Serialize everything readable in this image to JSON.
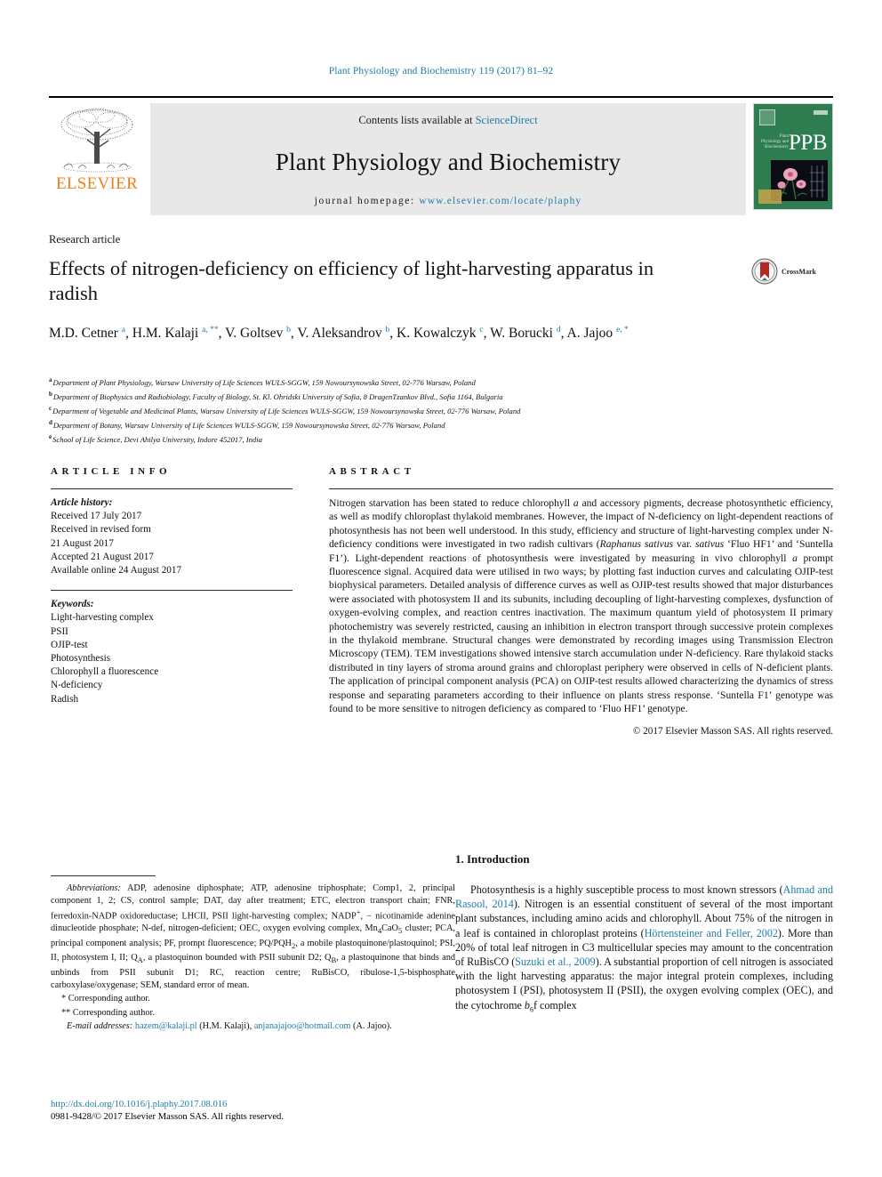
{
  "running_head": "Plant Physiology and Biochemistry 119 (2017) 81–92",
  "masthead": {
    "publisher": "ELSEVIER",
    "contents_prefix": "Contents lists available at",
    "contents_link": "ScienceDirect",
    "journal_title": "Plant Physiology and Biochemistry",
    "homepage_prefix": "journal homepage:",
    "homepage_url": "www.elsevier.com/locate/plaphy",
    "cover_badge": "PPB",
    "cover_caption": "Plant Physiology and Biochemistry"
  },
  "article": {
    "type": "Research article",
    "title": "Effects of nitrogen-deficiency on efficiency of light-harvesting apparatus in radish",
    "crossmark_label": "CrossMark",
    "authors_html": "M.D. Cetner <sup>a</sup>, H.M. Kalaji <sup>a, **</sup>, V. Goltsev <sup>b</sup>, V. Aleksandrov <sup>b</sup>, K. Kowalczyk <sup>c</sup>, W. Borucki <sup>d</sup>, A. Jajoo <sup>e, *</sup>",
    "affiliations": [
      {
        "mark": "a",
        "text": "Department of Plant Physiology, Warsaw University of Life Sciences WULS-SGGW, 159 Nowoursynowska Street, 02-776 Warsaw, Poland"
      },
      {
        "mark": "b",
        "text": "Department of Biophysics and Radiobiology, Faculty of Biology, St. Kl. Ohridski University of Sofia, 8 DragenTzankov Blvd., Sofia 1164, Bulgaria"
      },
      {
        "mark": "c",
        "text": "Department of Vegetable and Medicinal Plants, Warsaw University of Life Sciences WULS-SGGW, 159 Nowoursynowska Street, 02-776 Warsaw, Poland"
      },
      {
        "mark": "d",
        "text": "Department of Botany, Warsaw University of Life Sciences WULS-SGGW, 159 Nowoursynowska Street, 02-776 Warsaw, Poland"
      },
      {
        "mark": "e",
        "text": "School of Life Science, Devi Ahilya University, Indore 452017, India"
      }
    ]
  },
  "article_info": {
    "heading": "ARTICLE INFO",
    "history_label": "Article history:",
    "history_lines": [
      "Received 17 July 2017",
      "Received in revised form",
      "21 August 2017",
      "Accepted 21 August 2017",
      "Available online 24 August 2017"
    ],
    "keywords_label": "Keywords:",
    "keywords": [
      "Light-harvesting complex",
      "PSII",
      "OJIP-test",
      "Photosynthesis",
      "Chlorophyll a fluorescence",
      "N-deficiency",
      "Radish"
    ]
  },
  "abstract": {
    "heading": "ABSTRACT",
    "text_html": "Nitrogen starvation has been stated to reduce chlorophyll <i>a</i> and accessory pigments, decrease photosynthetic efficiency, as well as modify chloroplast thylakoid membranes. However, the impact of N-deficiency on light-dependent reactions of photosynthesis has not been well understood. In this study, efficiency and structure of light-harvesting complex under N-deficiency conditions were investigated in two radish cultivars (<i>Raphanus sativus</i> var. <i>sativus</i> ‘Fluo HF1’ and ‘Suntella F1’). Light-dependent reactions of photosynthesis were investigated by measuring in vivo chlorophyll <i>a</i> prompt fluorescence signal. Acquired data were utilised in two ways; by plotting fast induction curves and calculating OJIP-test biophysical parameters. Detailed analysis of difference curves as well as OJIP-test results showed that major disturbances were associated with photosystem II and its subunits, including decoupling of light-harvesting complexes, dysfunction of oxygen-evolving complex, and reaction centres inactivation. The maximum quantum yield of photosystem II primary photochemistry was severely restricted, causing an inhibition in electron transport through successive protein complexes in the thylakoid membrane. Structural changes were demonstrated by recording images using Transmission Electron Microscopy (TEM). TEM investigations showed intensive starch accumulation under N-deficiency. Rare thylakoid stacks distributed in tiny layers of stroma around grains and chloroplast periphery were observed in cells of N-deficient plants. The application of principal component analysis (PCA) on OJIP-test results allowed characterizing the dynamics of stress response and separating parameters according to their influence on plants stress response. ‘Suntella F1’ genotype was found to be more sensitive to nitrogen deficiency as compared to ‘Fluo HF1’ genotype.",
    "copyright": "© 2017 Elsevier Masson SAS. All rights reserved."
  },
  "footnotes": {
    "abbreviations_html": "<span class=\"ital\">Abbreviations:</span> ADP, adenosine diphosphate; ATP, adenosine triphosphate; Comp1, 2, principal component 1, 2; CS, control sample; DAT, day after treatment; ETC, electron transport chain; FNR, ferredoxin-NADP oxidoreductase; LHCII, PSII light-harvesting complex; NADP<sup>+</sup>, &minus; nicotinamide adenine dinucleotide phosphate; N-def, nitrogen-deficient; OEC, oxygen evolving complex, Mn<sub>4</sub>CaO<sub>5</sub> cluster; PCA, principal component analysis; PF, prompt fluorescence; PQ/PQH<sub>2</sub>, a mobile plastoquinone/plastoquinol; PSI, II, photosystem I, II; Q<sub>A</sub>, a plastoquinon bounded with PSII subunit D2; Q<sub>B</sub>, a plastoquinone that binds and unbinds from PSII subunit D1; RC, reaction centre; RuBisCO, ribulose-1,5-bisphosphate carboxylase/oxygenase; SEM, standard error of mean.",
    "corresponding_1": "* Corresponding author.",
    "corresponding_2": "** Corresponding author.",
    "email_label": "E-mail addresses:",
    "email_1": "hazem@kalaji.pl",
    "email_1_owner": "(H.M. Kalaji),",
    "email_2": "anjanajajoo@hotmail.com",
    "email_2_owner": "(A. Jajoo).",
    "doi": "http://dx.doi.org/10.1016/j.plaphy.2017.08.016",
    "issn_line": "0981-9428/© 2017 Elsevier Masson SAS. All rights reserved."
  },
  "introduction": {
    "heading": "1. Introduction",
    "paragraph_html": "Photosynthesis is a highly susceptible process to most known stressors (<span class=\"link\">Ahmad and Rasool, 2014</span>). Nitrogen is an essential constituent of several of the most important plant substances, including amino acids and chlorophyll. About 75% of the nitrogen in a leaf is contained in chloroplast proteins (<span class=\"link\">Hörtensteiner and Feller, 2002</span>). More than 20% of total leaf nitrogen in C3 multicellular species may amount to the concentration of RuBisCO (<span class=\"link\">Suzuki et al., 2009</span>). A substantial proportion of cell nitrogen is associated with the light harvesting apparatus: the major integral protein complexes, including photosystem I (PSI), photosystem II (PSII), the oxygen evolving complex (OEC), and the cytochrome <i>b</i><sub>6</sub>f complex"
  },
  "colors": {
    "link": "#1F7CA8",
    "elsevier_orange": "#F07F1A",
    "cover_green": "#2E7D50",
    "masthead_grey": "#E8E8E8"
  }
}
